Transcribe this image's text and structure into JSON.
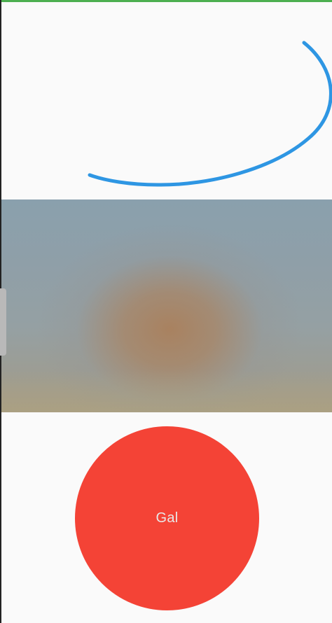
{
  "colors": {
    "status_accent": "#4caf50",
    "arc_stroke": "#2e96e3",
    "circle_fill": "#f44336",
    "background": "#fafafa"
  },
  "circle_button": {
    "label": "Gal"
  }
}
